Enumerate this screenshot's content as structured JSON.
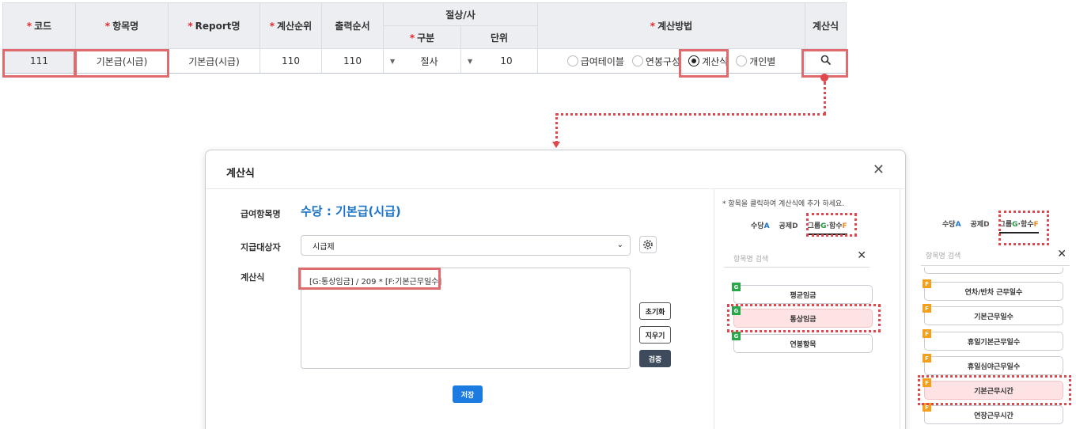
{
  "grid": {
    "headers": {
      "code": "코드",
      "item_name": "항목명",
      "report_name": "Report명",
      "calc_order": "계산순위",
      "print_order": "출력순서",
      "rounding": "절상/사",
      "rounding_type": "구분",
      "rounding_unit": "단위",
      "calc_method": "계산방법",
      "formula": "계산식"
    },
    "required_mark": "*",
    "row": {
      "code": "111",
      "item_name": "기본급(시급)",
      "report_name": "기본급(시급)",
      "calc_order": "110",
      "print_order": "110",
      "rounding_type": "절사",
      "rounding_unit": "10",
      "methods": [
        {
          "label": "급여테이블",
          "selected": false
        },
        {
          "label": "연봉구성",
          "selected": false
        },
        {
          "label": "계산식",
          "selected": true
        },
        {
          "label": "개인별",
          "selected": false
        }
      ]
    }
  },
  "dialog": {
    "title": "계산식",
    "labels": {
      "item": "급여항목명",
      "target": "지급대상자",
      "formula": "계산식"
    },
    "item_value": "수당 : 기본급(시급)",
    "target_value": "시급제",
    "formula_value": "[G:통상임금] / 209 * [F:기본근무일수]",
    "buttons": {
      "reset": "초기화",
      "clear": "지우기",
      "verify": "검증",
      "save": "저장"
    },
    "hint": "* 항목을 클릭하여 계산식에 추가 하세요.",
    "tabs": [
      {
        "text": "수당",
        "code": "A"
      },
      {
        "text": "공제",
        "code": "D"
      },
      {
        "text": "그룹",
        "code": "G",
        "sep": "·",
        "text2": "함수",
        "code2": "F"
      }
    ],
    "search_placeholder": "항목명 검색",
    "chips": [
      {
        "badge": "G",
        "label": "평균임금"
      },
      {
        "badge": "G",
        "label": "통상임금"
      },
      {
        "badge": "G",
        "label": "연봉항목"
      }
    ]
  },
  "side_panel": {
    "search_placeholder": "항목명 검색",
    "chips": [
      {
        "badge": "F",
        "label": "연차/반차 근무일수"
      },
      {
        "badge": "F",
        "label": "기본근무일수"
      },
      {
        "badge": "F",
        "label": "휴일기본근무일수"
      },
      {
        "badge": "F",
        "label": "휴일심야근무일수"
      },
      {
        "badge": "F",
        "label": "기본근무시간"
      },
      {
        "badge": "F",
        "label": "연장근무시간"
      }
    ]
  },
  "colors": {
    "accent": "#1a73c7",
    "highlight": "#e06b6f",
    "group": "#29a84a",
    "function": "#f5a01c"
  }
}
